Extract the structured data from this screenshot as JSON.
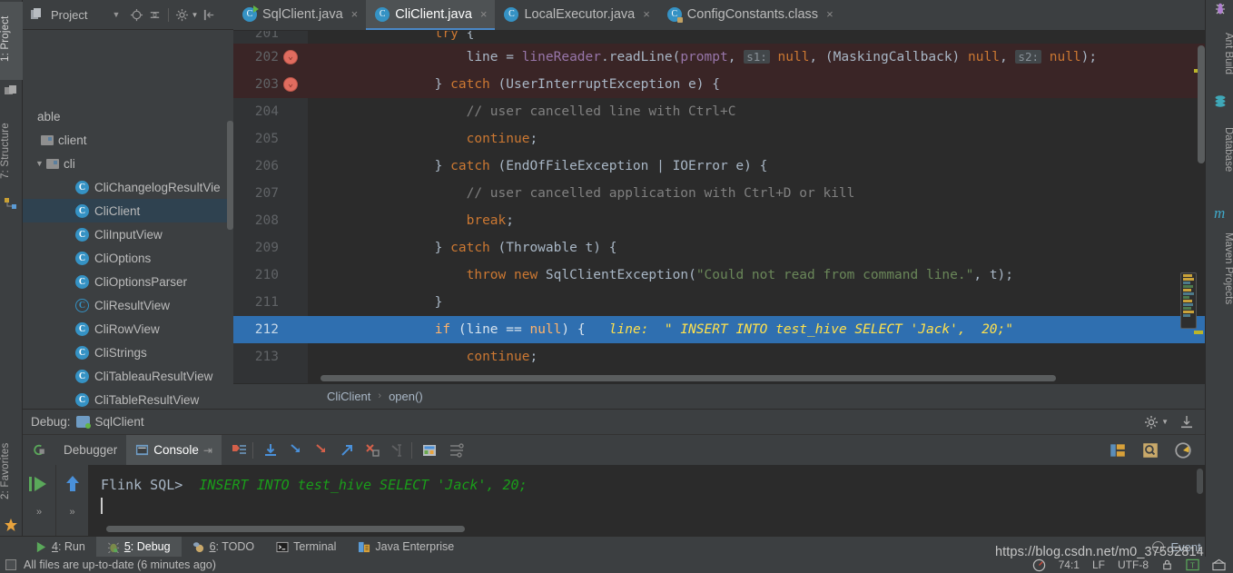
{
  "left_strip": {
    "items": [
      {
        "label": "1: Project",
        "icon": "project-icon",
        "active": true
      },
      {
        "label": "7: Structure",
        "icon": "structure-icon",
        "active": false
      },
      {
        "label": "2: Favorites",
        "icon": "star-icon",
        "active": false
      }
    ]
  },
  "project_panel": {
    "title": "Project",
    "icons": [
      "chevron-down-icon",
      "locate-icon",
      "collapse-all-icon",
      "gear-icon",
      "hide-icon"
    ],
    "tree": [
      {
        "label": "able",
        "type": "text",
        "indent": 0,
        "twisty": "",
        "selected": false
      },
      {
        "label": "client",
        "type": "folder",
        "indent": 1,
        "twisty": "",
        "selected": false
      },
      {
        "label": "cli",
        "type": "folder",
        "indent": 2,
        "twisty": "▼",
        "selected": false
      },
      {
        "label": "CliChangelogResultVie",
        "type": "class",
        "indent": 3,
        "twisty": "",
        "selected": false
      },
      {
        "label": "CliClient",
        "type": "class",
        "indent": 3,
        "twisty": "",
        "selected": true
      },
      {
        "label": "CliInputView",
        "type": "class",
        "indent": 3,
        "twisty": "",
        "selected": false
      },
      {
        "label": "CliOptions",
        "type": "class",
        "indent": 3,
        "twisty": "",
        "selected": false
      },
      {
        "label": "CliOptionsParser",
        "type": "class",
        "indent": 3,
        "twisty": "",
        "selected": false
      },
      {
        "label": "CliResultView",
        "type": "interface",
        "indent": 3,
        "twisty": "",
        "selected": false
      },
      {
        "label": "CliRowView",
        "type": "class",
        "indent": 3,
        "twisty": "",
        "selected": false
      },
      {
        "label": "CliStrings",
        "type": "final",
        "indent": 3,
        "twisty": "",
        "selected": false
      },
      {
        "label": "CliTableauResultView",
        "type": "class",
        "indent": 3,
        "twisty": "",
        "selected": false
      },
      {
        "label": "CliTableResultView",
        "type": "class",
        "indent": 3,
        "twisty": "",
        "selected": false
      }
    ]
  },
  "tabs": [
    {
      "label": "SqlClient.java",
      "icon": "java-runnable-class-icon",
      "active": false,
      "close": "×"
    },
    {
      "label": "CliClient.java",
      "icon": "java-class-icon",
      "active": true,
      "close": "×"
    },
    {
      "label": "LocalExecutor.java",
      "icon": "java-class-icon",
      "active": false,
      "close": "×"
    },
    {
      "label": "ConfigConstants.class",
      "icon": "compiled-class-icon",
      "active": false,
      "close": "×"
    }
  ],
  "editor": {
    "lines": [
      {
        "num": "201",
        "state": "normal",
        "breakpoint": false,
        "partial": true,
        "tokens": [
          {
            "t": "                ",
            "c": "plain"
          },
          {
            "t": "try",
            "c": "kw"
          },
          {
            "t": " {",
            "c": "plain"
          }
        ]
      },
      {
        "num": "202",
        "state": "err",
        "breakpoint": true,
        "tokens": [
          {
            "t": "                    line = ",
            "c": "plain"
          },
          {
            "t": "lineReader",
            "c": "fld"
          },
          {
            "t": ".readLine(",
            "c": "plain"
          },
          {
            "t": "prompt",
            "c": "fld"
          },
          {
            "t": ", ",
            "c": "plain"
          },
          {
            "t": "s1:",
            "c": "hint"
          },
          {
            "t": " ",
            "c": "plain"
          },
          {
            "t": "null",
            "c": "kw"
          },
          {
            "t": ", (MaskingCallback) ",
            "c": "plain"
          },
          {
            "t": "null",
            "c": "kw"
          },
          {
            "t": ", ",
            "c": "plain"
          },
          {
            "t": "s2:",
            "c": "hint"
          },
          {
            "t": " ",
            "c": "plain"
          },
          {
            "t": "null",
            "c": "kw"
          },
          {
            "t": ");",
            "c": "plain"
          }
        ]
      },
      {
        "num": "203",
        "state": "err",
        "breakpoint": true,
        "tokens": [
          {
            "t": "                } ",
            "c": "plain"
          },
          {
            "t": "catch",
            "c": "kw"
          },
          {
            "t": " (UserInterruptException e) {",
            "c": "plain"
          }
        ]
      },
      {
        "num": "204",
        "state": "normal",
        "breakpoint": false,
        "tokens": [
          {
            "t": "                    ",
            "c": "plain"
          },
          {
            "t": "// user cancelled line with Ctrl+C",
            "c": "cmt"
          }
        ]
      },
      {
        "num": "205",
        "state": "normal",
        "breakpoint": false,
        "tokens": [
          {
            "t": "                    ",
            "c": "plain"
          },
          {
            "t": "continue",
            "c": "kw"
          },
          {
            "t": ";",
            "c": "plain"
          }
        ]
      },
      {
        "num": "206",
        "state": "normal",
        "breakpoint": false,
        "tokens": [
          {
            "t": "                } ",
            "c": "plain"
          },
          {
            "t": "catch",
            "c": "kw"
          },
          {
            "t": " (EndOfFileException | IOError e) {",
            "c": "plain"
          }
        ]
      },
      {
        "num": "207",
        "state": "normal",
        "breakpoint": false,
        "tokens": [
          {
            "t": "                    ",
            "c": "plain"
          },
          {
            "t": "// user cancelled application with Ctrl+D or kill",
            "c": "cmt"
          }
        ]
      },
      {
        "num": "208",
        "state": "normal",
        "breakpoint": false,
        "tokens": [
          {
            "t": "                    ",
            "c": "plain"
          },
          {
            "t": "break",
            "c": "kw"
          },
          {
            "t": ";",
            "c": "plain"
          }
        ]
      },
      {
        "num": "209",
        "state": "normal",
        "breakpoint": false,
        "tokens": [
          {
            "t": "                } ",
            "c": "plain"
          },
          {
            "t": "catch",
            "c": "kw"
          },
          {
            "t": " (Throwable t) {",
            "c": "plain"
          }
        ]
      },
      {
        "num": "210",
        "state": "normal",
        "breakpoint": false,
        "tokens": [
          {
            "t": "                    ",
            "c": "plain"
          },
          {
            "t": "throw",
            "c": "kw"
          },
          {
            "t": " ",
            "c": "plain"
          },
          {
            "t": "new",
            "c": "kw"
          },
          {
            "t": " SqlClientException(",
            "c": "plain"
          },
          {
            "t": "\"Could not read from command line.\"",
            "c": "str"
          },
          {
            "t": ", t);",
            "c": "plain"
          }
        ]
      },
      {
        "num": "211",
        "state": "normal",
        "breakpoint": false,
        "tokens": [
          {
            "t": "                }",
            "c": "plain"
          }
        ]
      },
      {
        "num": "212",
        "state": "cur",
        "breakpoint": false,
        "tokens": [
          {
            "t": "                ",
            "c": "plain"
          },
          {
            "t": "if",
            "c": "kw-cur"
          },
          {
            "t": " (line == ",
            "c": "plain"
          },
          {
            "t": "null",
            "c": "kw-cur"
          },
          {
            "t": ") {",
            "c": "plain"
          }
        ],
        "inline_value": "   line:  \" INSERT INTO test_hive SELECT 'Jack',  20;\""
      },
      {
        "num": "213",
        "state": "normal",
        "breakpoint": false,
        "tokens": [
          {
            "t": "                    ",
            "c": "plain"
          },
          {
            "t": "continue",
            "c": "kw"
          },
          {
            "t": ";",
            "c": "plain"
          }
        ]
      }
    ]
  },
  "breadcrumb": {
    "class": "CliClient",
    "separator": "›",
    "method": "open()"
  },
  "debug": {
    "window_label": "Debug:",
    "config_name": "SqlClient",
    "tabs": [
      {
        "label": "Debugger",
        "icon": "debugger-icon",
        "active": false
      },
      {
        "label": "Console",
        "icon": "console-icon",
        "active": true
      }
    ],
    "toolbar_icons": [
      "show-execution-point-icon",
      "step-over-icon",
      "step-into-icon",
      "force-step-into-icon",
      "step-out-icon",
      "drop-frame-icon",
      "run-to-cursor-icon",
      "evaluate-expression-icon",
      "settings-icon"
    ],
    "header_icons": [
      "gear-dropdown-icon",
      "hide-icon"
    ],
    "right_icons": [
      "layout-icon",
      "inspect-icon",
      "profiler-icon"
    ],
    "rail_icons": [
      "resume-program-icon",
      "scroll-up-icon"
    ],
    "rail_more": "»"
  },
  "console": {
    "prompt": "Flink SQL> ",
    "command": " INSERT INTO test_hive SELECT 'Jack', 20;"
  },
  "bottom_bar": {
    "items": [
      {
        "num": "4",
        "label": ": Run",
        "icon": "run-icon",
        "active": false
      },
      {
        "num": "5",
        "label": ": Debug",
        "icon": "debug-icon",
        "active": true
      },
      {
        "num": "6",
        "label": ": TODO",
        "icon": "todo-icon",
        "active": false
      },
      {
        "num": "",
        "label": "Terminal",
        "icon": "terminal-icon",
        "active": false
      },
      {
        "num": "",
        "label": "Java Enterprise",
        "icon": "java-enterprise-icon",
        "active": false
      }
    ],
    "event_log": "Event Log"
  },
  "status_bar": {
    "message": "All files are up-to-date (6 minutes ago)",
    "position": "74:1",
    "line_separator": "LF",
    "encoding": "UTF-8",
    "icons": [
      "lock-icon",
      "read-only-icon",
      "ide-icon"
    ]
  },
  "right_strip": {
    "items": [
      {
        "label": "Ant Build",
        "icon": "ant-icon"
      },
      {
        "label": "Database",
        "icon": "database-icon"
      },
      {
        "label": "Maven Projects",
        "icon": "maven-icon"
      }
    ]
  },
  "watermark": {
    "text": "https://blog.csdn.net/m0_37592814"
  },
  "colors": {
    "accent": "#4a88c7",
    "current_line": "#2f6fb0",
    "error_line": "#3a2526",
    "keyword": "#cc7832",
    "string": "#6a8759",
    "comment": "#808080",
    "field": "#9876aa",
    "inline_value": "#ffe14d",
    "console_sql": "#1a9e1a",
    "breakpoint": "#e06c5f",
    "background": "#3c3f41",
    "editor_bg": "#2b2b2b"
  }
}
